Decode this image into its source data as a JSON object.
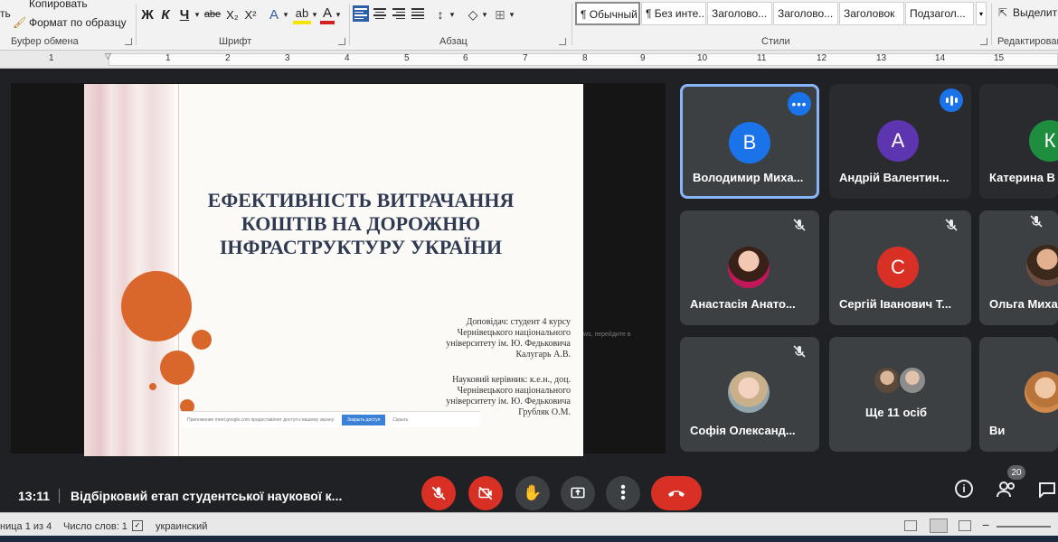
{
  "ribbon": {
    "clipboard": {
      "cut_label": "ть",
      "copy_label": "Копировать",
      "format_painter_label": "Формат по образцу",
      "group_label": "Буфер обмена"
    },
    "font": {
      "group_label": "Шрифт",
      "bold": "Ж",
      "italic": "К",
      "underline": "Ч",
      "strike": "abe",
      "subscript": "X₂",
      "superscript": "X²"
    },
    "paragraph": {
      "group_label": "Абзац"
    },
    "styles": {
      "group_label": "Стили",
      "items": [
        "¶ Обычный",
        "¶ Без инте...",
        "Заголово...",
        "Заголово...",
        "Заголовок",
        "Подзагол..."
      ],
      "selected_index": 0
    },
    "editing": {
      "find_label": "Выделить",
      "group_label": "Редактирован"
    }
  },
  "ruler": {
    "ticks": [
      "1",
      "1",
      "2",
      "3",
      "4",
      "5",
      "6",
      "7",
      "8",
      "9",
      "10",
      "11",
      "12",
      "13",
      "14",
      "15"
    ]
  },
  "slide": {
    "title": "ЕФЕКТИВНІСТЬ ВИТРАЧАННЯ КОШТІВ НА ДОРОЖНЮ ІНФРАСТРУКТУРУ УКРАЇНИ",
    "speaker_lines": [
      "Доповідач: студент 4 курсу",
      "Чернівецького національного",
      "університету ім. Ю. Федьковича",
      "Калугарь А.В."
    ],
    "advisor_lines": [
      "Науковий керівник: к.е.н., доц.",
      "Чернівецького національного",
      "університету ім. Ю. Федьковича",
      "Грубляк О.М."
    ],
    "share_notice": "Приложение meet.google.com предоставляет доступ к вашему экрану.",
    "share_stop": "Закрыть доступ",
    "share_hide": "Скрыть",
    "hint_text": "ws, перейдите в"
  },
  "participants": [
    {
      "name": "Володимир Миха...",
      "initial": "В",
      "color": "#1a73e8",
      "kind": "letter",
      "active": true,
      "badge": "more"
    },
    {
      "name": "Андрій Валентин...",
      "initial": "А",
      "color": "#5e35b1",
      "kind": "letter",
      "badge": "speaking"
    },
    {
      "name": "Катерина В",
      "initial": "К",
      "color": "#1e8e3e",
      "kind": "letter"
    },
    {
      "name": "Анастасія Анато...",
      "kind": "photo",
      "muted": true,
      "color": "#c2185b"
    },
    {
      "name": "Сергій Іванович Т...",
      "initial": "С",
      "color": "#d93025",
      "kind": "letter",
      "muted": true
    },
    {
      "name": "Ольга Миха",
      "kind": "photo",
      "muted": true,
      "color": "#6d4c41"
    },
    {
      "name": "Софія Олександ...",
      "kind": "photo",
      "muted": true,
      "color": "#90a4ae"
    },
    {
      "name": "Ще 11 осіб",
      "kind": "group"
    },
    {
      "name": "Ви",
      "kind": "photo",
      "color": "#d18a4a"
    }
  ],
  "meeting": {
    "time": "13:11",
    "title": "Відбірковий етап студентської наукової к...",
    "people_count": "20"
  },
  "statusbar": {
    "page": "ница 1 из 4",
    "words": "Число слов: 1",
    "language": "украинский"
  },
  "colors": {
    "accent": "#1a73e8",
    "end_call": "#d93025",
    "slide_orange": "#d9662b"
  }
}
